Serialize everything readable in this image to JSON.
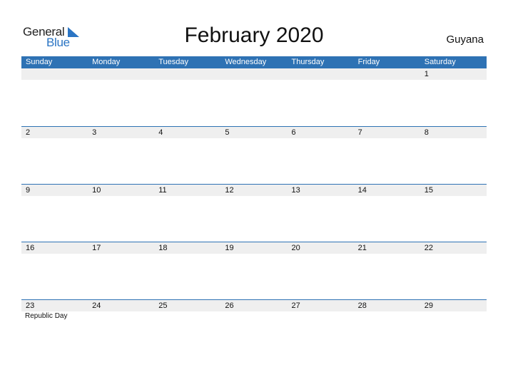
{
  "logo": {
    "general": "General",
    "blue": "Blue"
  },
  "title": "February 2020",
  "country": "Guyana",
  "weekdays": [
    "Sunday",
    "Monday",
    "Tuesday",
    "Wednesday",
    "Thursday",
    "Friday",
    "Saturday"
  ],
  "weeks": [
    {
      "dates": [
        "",
        "",
        "",
        "",
        "",
        "",
        "1"
      ],
      "events": [
        "",
        "",
        "",
        "",
        "",
        "",
        ""
      ]
    },
    {
      "dates": [
        "2",
        "3",
        "4",
        "5",
        "6",
        "7",
        "8"
      ],
      "events": [
        "",
        "",
        "",
        "",
        "",
        "",
        ""
      ]
    },
    {
      "dates": [
        "9",
        "10",
        "11",
        "12",
        "13",
        "14",
        "15"
      ],
      "events": [
        "",
        "",
        "",
        "",
        "",
        "",
        ""
      ]
    },
    {
      "dates": [
        "16",
        "17",
        "18",
        "19",
        "20",
        "21",
        "22"
      ],
      "events": [
        "",
        "",
        "",
        "",
        "",
        "",
        ""
      ]
    },
    {
      "dates": [
        "23",
        "24",
        "25",
        "26",
        "27",
        "28",
        "29"
      ],
      "events": [
        "Republic Day",
        "",
        "",
        "",
        "",
        "",
        ""
      ]
    }
  ],
  "colors": {
    "header": "#2e72b4",
    "date_strip": "#efefef",
    "brand_blue": "#2b75c4"
  }
}
